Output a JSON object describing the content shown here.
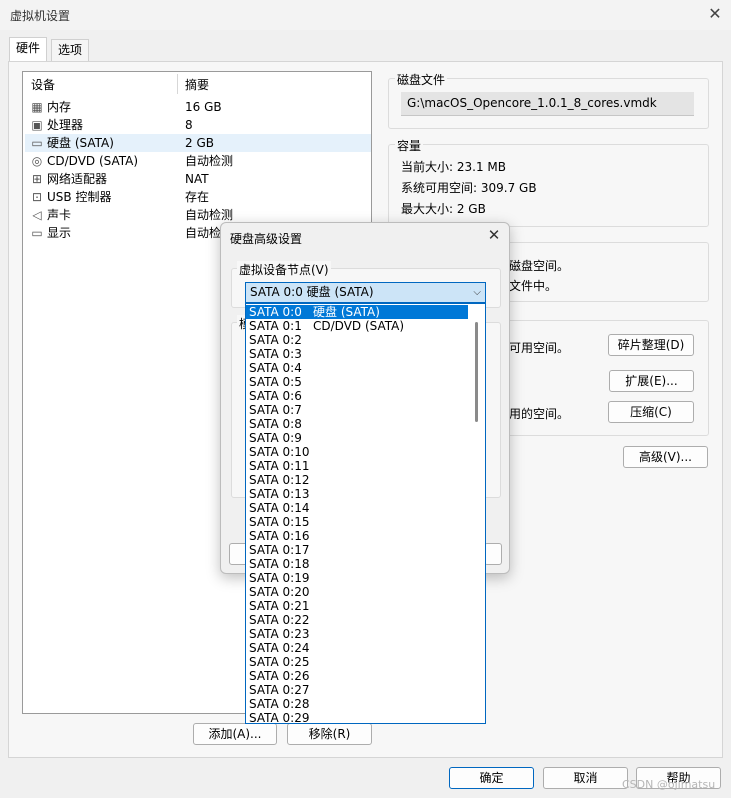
{
  "window": {
    "title": "虚拟机设置"
  },
  "tabs": [
    {
      "label": "硬件"
    },
    {
      "label": "选项"
    }
  ],
  "devices": {
    "col_device": "设备",
    "col_summary": "摘要",
    "rows": [
      {
        "name": "内存",
        "summary": "16 GB",
        "icon": "memory-icon"
      },
      {
        "name": "处理器",
        "summary": "8",
        "icon": "cpu-icon"
      },
      {
        "name": "硬盘 (SATA)",
        "summary": "2 GB",
        "icon": "hard-disk-icon"
      },
      {
        "name": "CD/DVD (SATA)",
        "summary": "自动检测",
        "icon": "cd-icon"
      },
      {
        "name": "网络适配器",
        "summary": "NAT",
        "icon": "network-icon"
      },
      {
        "name": "USB 控制器",
        "summary": "存在",
        "icon": "usb-icon"
      },
      {
        "name": "声卡",
        "summary": "自动检测",
        "icon": "speaker-icon"
      },
      {
        "name": "显示",
        "summary": "自动检",
        "icon": "monitor-icon"
      }
    ],
    "add_button": "添加(A)...",
    "remove_button": "移除(R)"
  },
  "disk_file": {
    "title": "磁盘文件",
    "value": "G:\\macOS_Opencore_1.0.1_8_cores.vmdk"
  },
  "capacity": {
    "title": "容量",
    "current": "当前大小: 23.1 MB",
    "available": "系统可用空间: 309.7 GB",
    "max": "最大大小: 2 GB"
  },
  "disk_info": {
    "line1": "磁盘空间。",
    "line2": "文件中。"
  },
  "utilities": {
    "defrag_text": "可用空间。",
    "defrag_button": "碎片整理(D)",
    "expand_button": "扩展(E)...",
    "compact_text": "用的空间。",
    "compact_button": "压缩(C)"
  },
  "advanced_button": "高级(V)...",
  "footer": {
    "ok": "确定",
    "cancel": "取消",
    "help": "帮助"
  },
  "dialog": {
    "title": "硬盘高级设置",
    "group_label": "虚拟设备节点(V)",
    "selected_value": "SATA 0:0   硬盘 (SATA)",
    "options": [
      {
        "label": "SATA 0:0",
        "device": "硬盘 (SATA)"
      },
      {
        "label": "SATA 0:1",
        "device": "CD/DVD (SATA)"
      },
      {
        "label": "SATA 0:2",
        "device": ""
      },
      {
        "label": "SATA 0:3",
        "device": ""
      },
      {
        "label": "SATA 0:4",
        "device": ""
      },
      {
        "label": "SATA 0:5",
        "device": ""
      },
      {
        "label": "SATA 0:6",
        "device": ""
      },
      {
        "label": "SATA 0:7",
        "device": ""
      },
      {
        "label": "SATA 0:8",
        "device": ""
      },
      {
        "label": "SATA 0:9",
        "device": ""
      },
      {
        "label": "SATA 0:10",
        "device": ""
      },
      {
        "label": "SATA 0:11",
        "device": ""
      },
      {
        "label": "SATA 0:12",
        "device": ""
      },
      {
        "label": "SATA 0:13",
        "device": ""
      },
      {
        "label": "SATA 0:14",
        "device": ""
      },
      {
        "label": "SATA 0:15",
        "device": ""
      },
      {
        "label": "SATA 0:16",
        "device": ""
      },
      {
        "label": "SATA 0:17",
        "device": ""
      },
      {
        "label": "SATA 0:18",
        "device": ""
      },
      {
        "label": "SATA 0:19",
        "device": ""
      },
      {
        "label": "SATA 0:20",
        "device": ""
      },
      {
        "label": "SATA 0:21",
        "device": ""
      },
      {
        "label": "SATA 0:22",
        "device": ""
      },
      {
        "label": "SATA 0:23",
        "device": ""
      },
      {
        "label": "SATA 0:24",
        "device": ""
      },
      {
        "label": "SATA 0:25",
        "device": ""
      },
      {
        "label": "SATA 0:26",
        "device": ""
      },
      {
        "label": "SATA 0:27",
        "device": ""
      },
      {
        "label": "SATA 0:28",
        "device": ""
      },
      {
        "label": "SATA 0:29",
        "device": ""
      }
    ],
    "hidden_mode_label": "模"
  },
  "watermark": "CSDN @ojimatsu"
}
